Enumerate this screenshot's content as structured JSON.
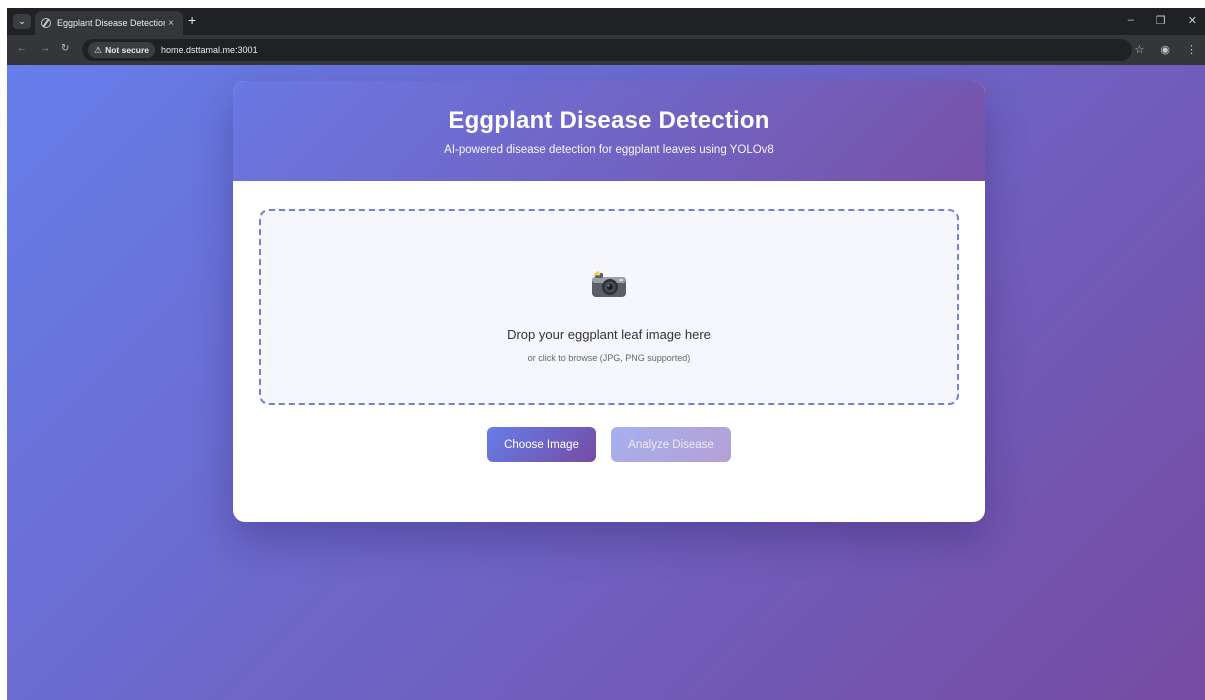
{
  "browser": {
    "tab_title": "Eggplant Disease Detection",
    "tab_close": "×",
    "new_tab": "+",
    "security_label": "Not secure",
    "url": "home.dsttamal.me:3001",
    "icons": {
      "tab_search": "chevron-down-icon",
      "favicon": "globe-icon",
      "back": "arrow-left-icon",
      "forward": "arrow-right-icon",
      "reload": "reload-icon",
      "warning": "warning-triangle-icon",
      "bookmark": "star-icon",
      "profile": "profile-icon",
      "menu": "kebab-menu-icon",
      "minimize": "minimize-icon",
      "restore": "restore-icon",
      "close": "close-icon"
    }
  },
  "page": {
    "title": "Eggplant Disease Detection",
    "subtitle": "AI-powered disease detection for eggplant leaves using YOLOv8",
    "dropzone": {
      "icon": "camera-icon",
      "title": "Drop your eggplant leaf image here",
      "hint": "or click to browse (JPG, PNG supported)"
    },
    "buttons": {
      "choose": "Choose Image",
      "analyze": "Analyze Disease"
    }
  },
  "colors": {
    "gradient_start": "#667eea",
    "gradient_end": "#764ba2",
    "dropzone_border": "#7380d6",
    "dropzone_bg": "#f6f7fc"
  }
}
